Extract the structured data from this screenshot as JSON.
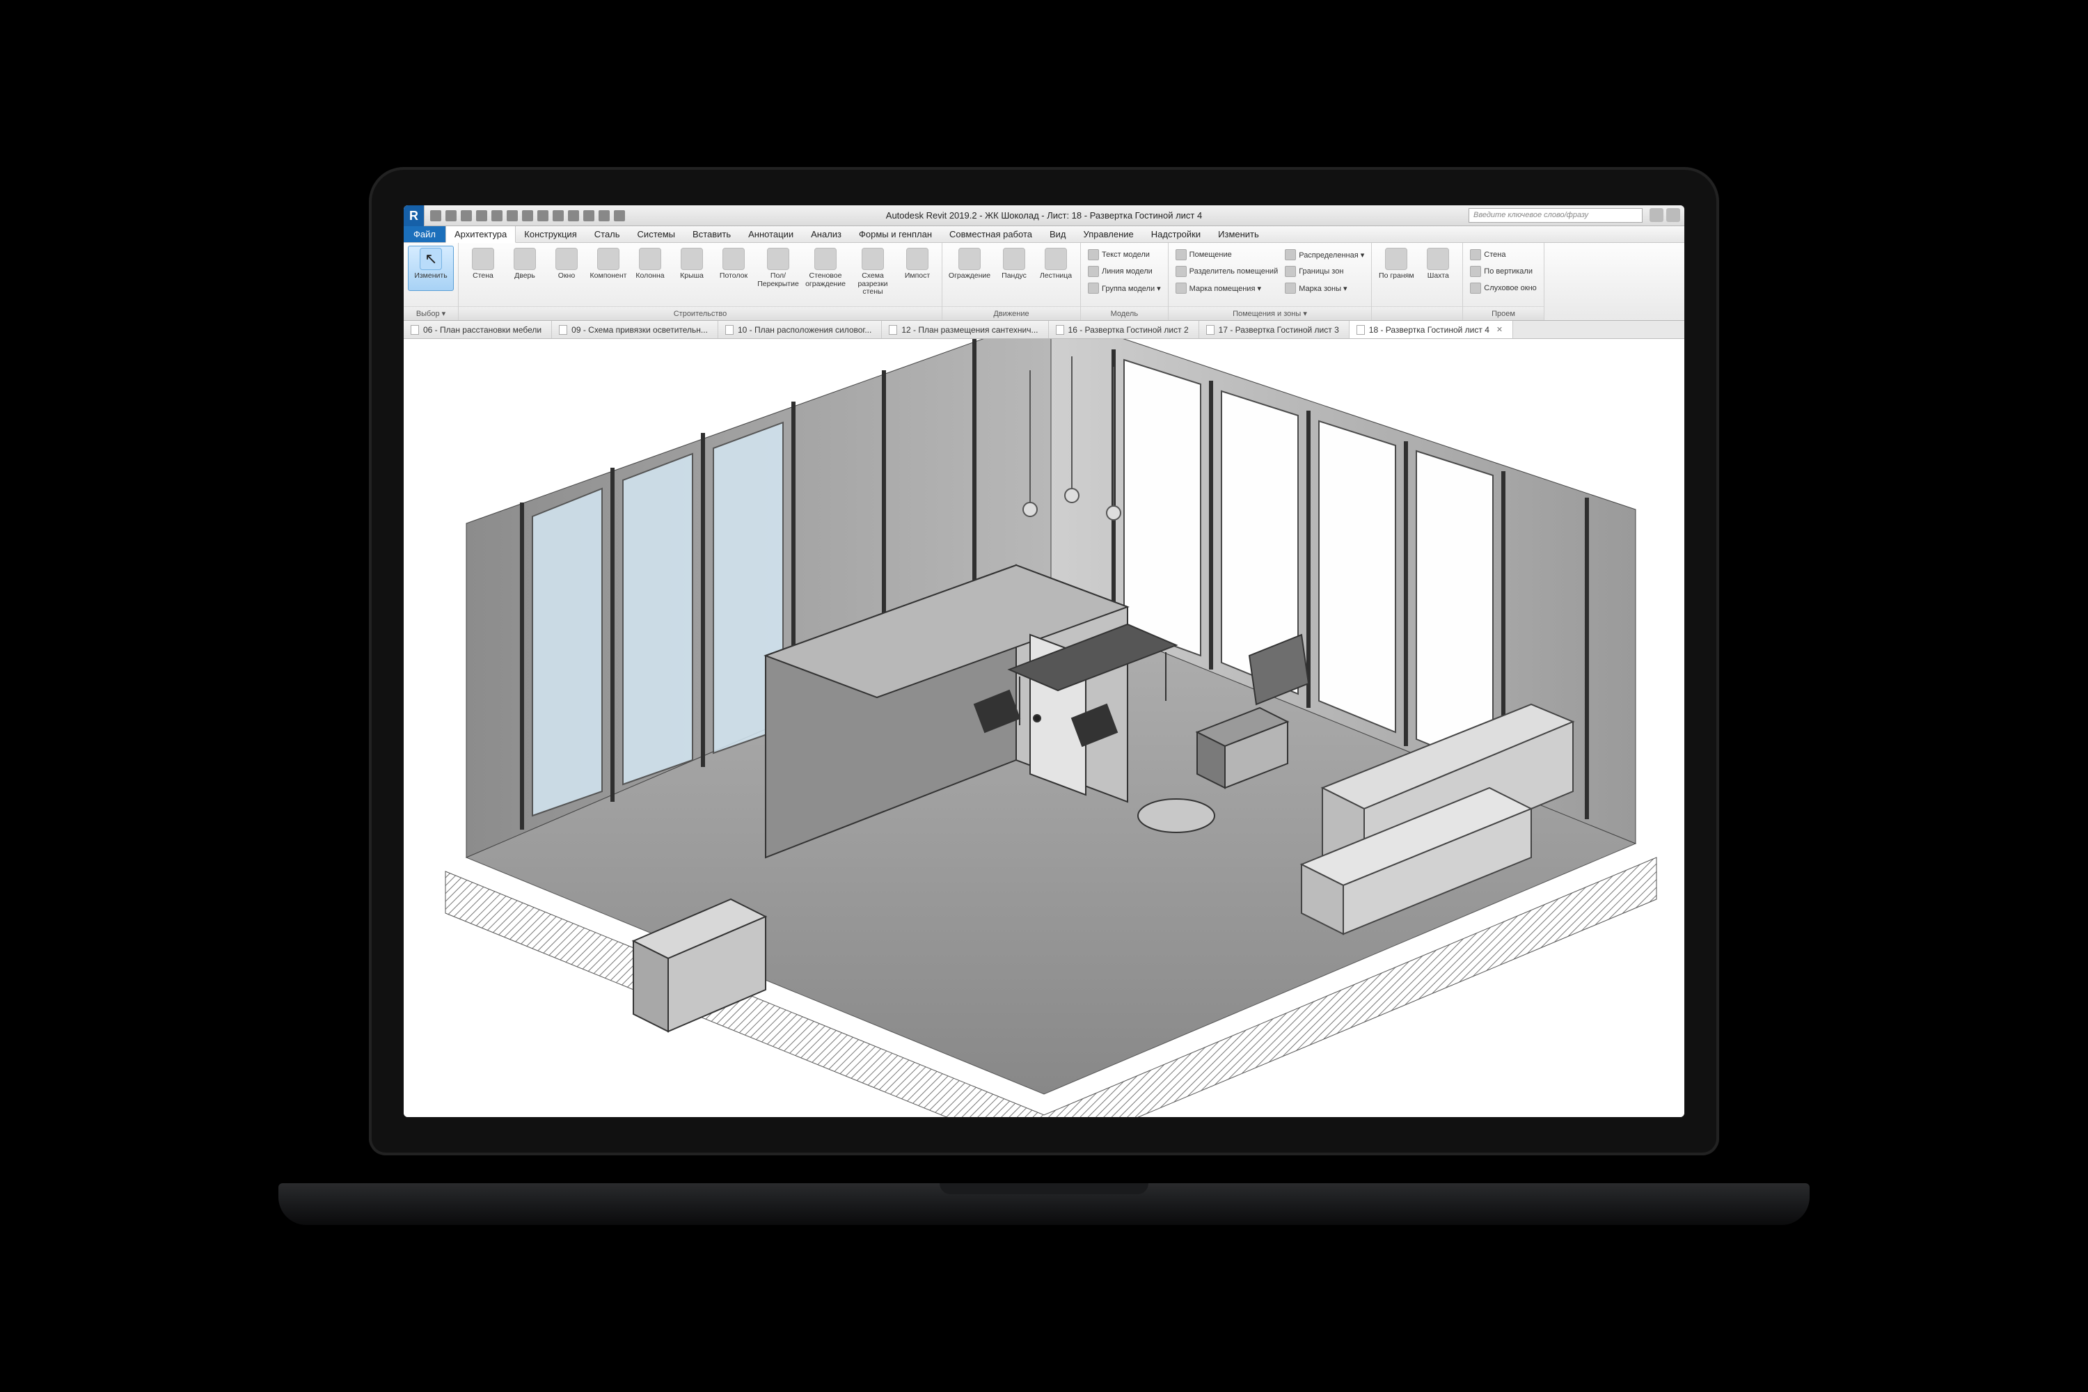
{
  "app": {
    "logo": "R",
    "title": "Autodesk Revit 2019.2 - ЖК Шоколад - Лист: 18 - Развертка Гостиной лист 4",
    "search_placeholder": "Введите ключевое слово/фразу"
  },
  "menu": {
    "file": "Файл",
    "tabs": [
      "Архитектура",
      "Конструкция",
      "Сталь",
      "Системы",
      "Вставить",
      "Аннотации",
      "Анализ",
      "Формы и генплан",
      "Совместная работа",
      "Вид",
      "Управление",
      "Надстройки",
      "Изменить"
    ],
    "active": 0
  },
  "ribbon": {
    "select": {
      "btn": "Изменить",
      "panel": "Выбор ▾"
    },
    "build": {
      "items": [
        "Стена",
        "Дверь",
        "Окно",
        "Компонент",
        "Колонна",
        "Крыша",
        "Потолок",
        "Пол/Перекрытие",
        "Стеновое ограждение",
        "Схема разрезки стены",
        "Импост"
      ],
      "panel": "Строительство"
    },
    "circ": {
      "items": [
        "Ограждение",
        "Пандус",
        "Лестница"
      ],
      "panel": "Движение"
    },
    "model": {
      "rows": [
        "Текст модели",
        "Линия модели",
        "Группа модели ▾"
      ],
      "panel": "Модель"
    },
    "rooms": {
      "col1": [
        "Помещение",
        "Разделитель помещений",
        "Марка помещения ▾"
      ],
      "col2": [
        "Распределенная ▾",
        "Границы зон",
        "Марка зоны ▾"
      ],
      "panel": "Помещения и зоны ▾"
    },
    "datum": {
      "items": [
        "По граням",
        "Шахта"
      ],
      "panel": ""
    },
    "open": {
      "rows": [
        "Стена",
        "По вертикали",
        "Слуховое окно"
      ],
      "panel": "Проем"
    }
  },
  "docTabs": [
    {
      "label": "06 - План расстановки мебели",
      "active": false
    },
    {
      "label": "09 - Схема привязки осветительн...",
      "active": false
    },
    {
      "label": "10 - План расположения силовог...",
      "active": false
    },
    {
      "label": "12 - План размещения сантехнич...",
      "active": false
    },
    {
      "label": "16 - Развертка Гостиной лист 2",
      "active": false
    },
    {
      "label": "17 - Развертка Гостиной лист 3",
      "active": false
    },
    {
      "label": "18 - Развертка Гостиной лист 4",
      "active": true
    }
  ]
}
